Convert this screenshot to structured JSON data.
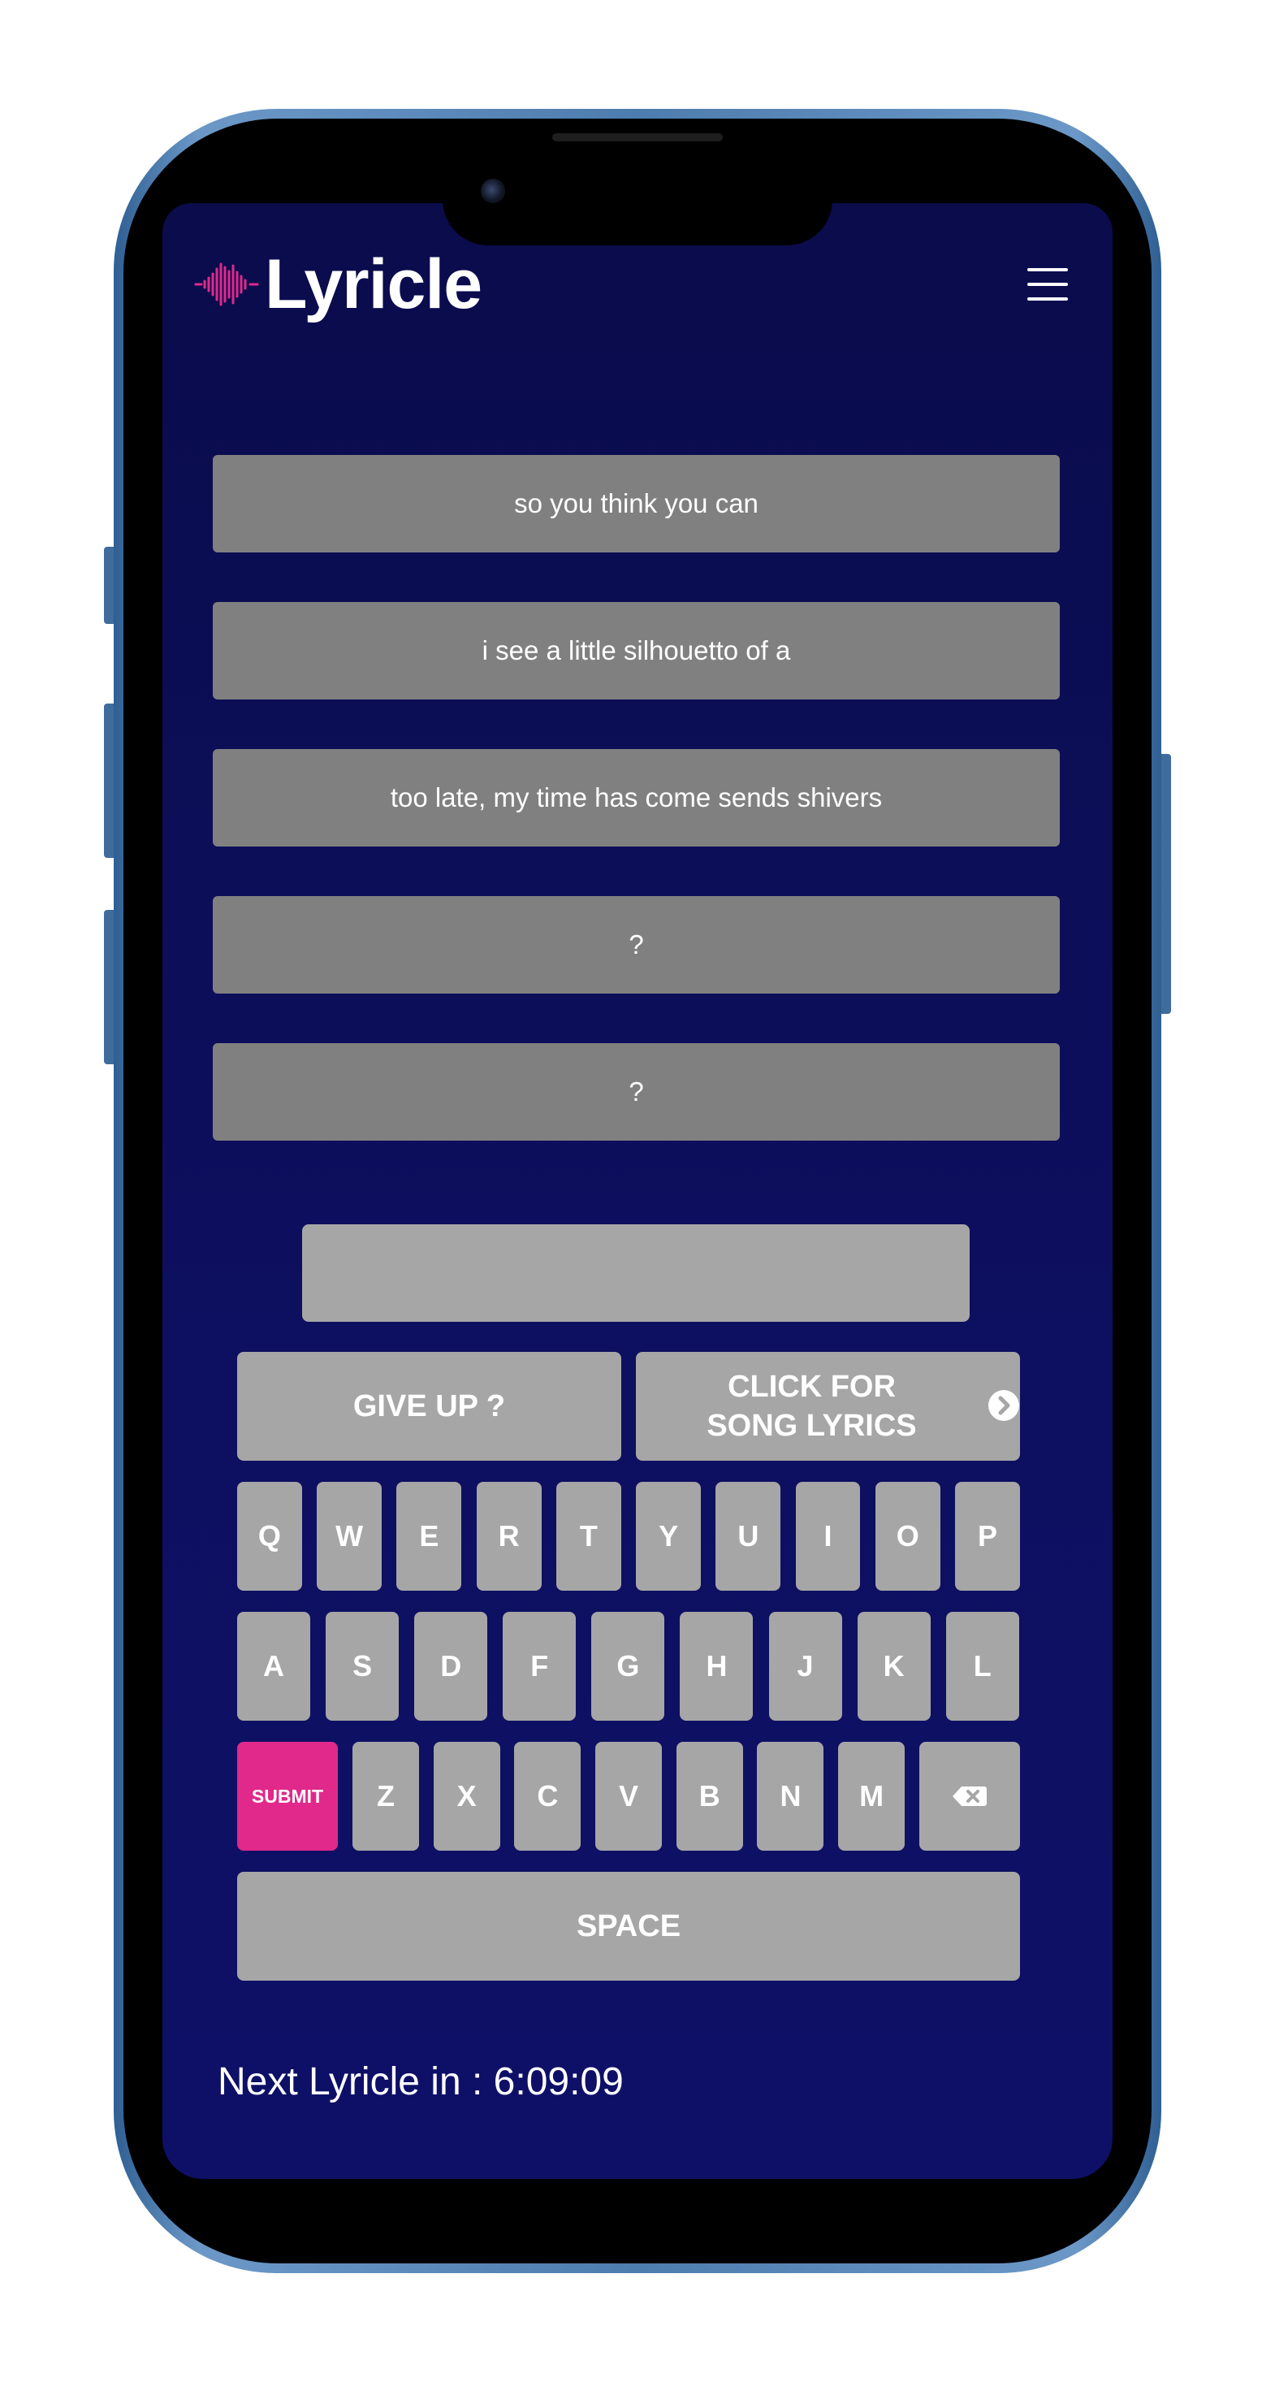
{
  "app": {
    "title": "Lyricle",
    "accent_color": "#e0298a",
    "background_color": "#0d0f5f"
  },
  "header": {
    "logo_icon": "soundwave-icon",
    "menu_icon": "hamburger-menu-icon"
  },
  "lyric_lines": [
    {
      "text": "so you think you can"
    },
    {
      "text": "i see a little silhouetto of a"
    },
    {
      "text": "too late, my time has come sends shivers"
    },
    {
      "text": "?"
    },
    {
      "text": "?"
    }
  ],
  "guess_input": {
    "value": "",
    "placeholder": ""
  },
  "actions": {
    "give_up": "GIVE UP ?",
    "song_lyrics": "CLICK FOR SONG LYRICS",
    "song_lyrics_icon": "chevron-right-circle-icon"
  },
  "keyboard": {
    "row1": [
      "Q",
      "W",
      "E",
      "R",
      "T",
      "Y",
      "U",
      "I",
      "O",
      "P"
    ],
    "row2": [
      "A",
      "S",
      "D",
      "F",
      "G",
      "H",
      "J",
      "K",
      "L"
    ],
    "row3": [
      "Z",
      "X",
      "C",
      "V",
      "B",
      "N",
      "M"
    ],
    "submit": "SUBMIT",
    "backspace_icon": "backspace-icon",
    "space": "SPACE"
  },
  "footer": {
    "next_label": "Next Lyricle in : 6:09:09"
  }
}
